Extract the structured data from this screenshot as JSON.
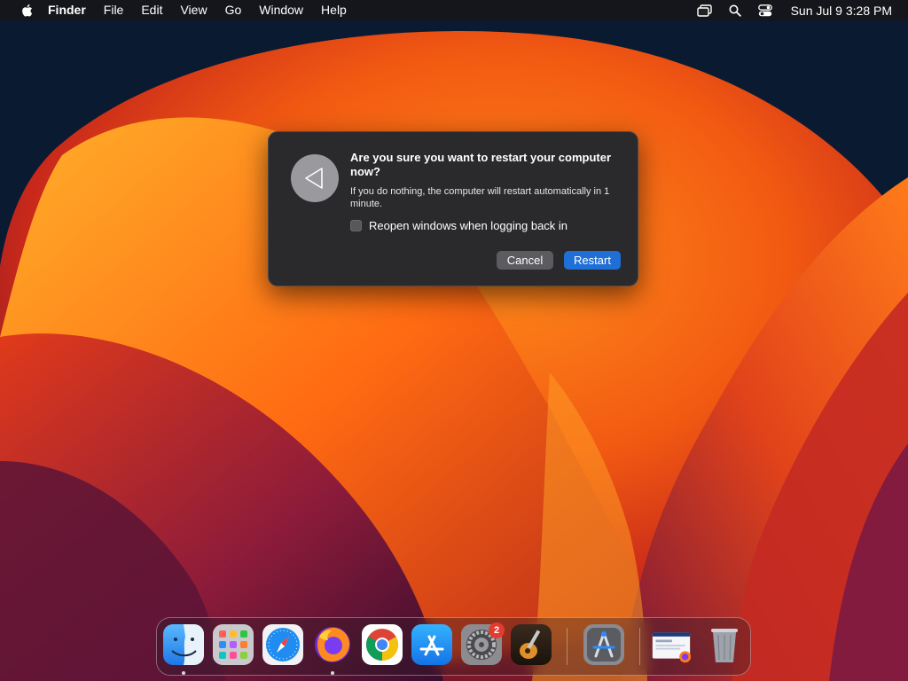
{
  "menubar": {
    "app_name": "Finder",
    "menus": [
      "File",
      "Edit",
      "View",
      "Go",
      "Window",
      "Help"
    ],
    "status_icons": [
      "screen-mirroring-icon",
      "spotlight-search-icon",
      "control-center-icon"
    ],
    "clock": "Sun Jul 9  3:28 PM"
  },
  "dialog": {
    "icon": "restart-icon",
    "title": "Are you sure you want to restart your computer now?",
    "message": "If you do nothing, the computer will restart automatically in 1 minute.",
    "checkbox_label": "Reopen windows when logging back in",
    "checkbox_checked": false,
    "cancel_label": "Cancel",
    "restart_label": "Restart",
    "accent_color": "#1f6fd6"
  },
  "dock": {
    "apps": [
      {
        "name": "Finder",
        "icon": "finder-icon",
        "running": true
      },
      {
        "name": "Launchpad",
        "icon": "launchpad-icon",
        "running": false
      },
      {
        "name": "Safari",
        "icon": "safari-icon",
        "running": false
      },
      {
        "name": "Firefox",
        "icon": "firefox-icon",
        "running": true
      },
      {
        "name": "Chrome",
        "icon": "chrome-icon",
        "running": false
      },
      {
        "name": "App Store",
        "icon": "app-store-icon",
        "running": false
      },
      {
        "name": "System Settings",
        "icon": "system-settings-icon",
        "running": false,
        "badge": "2"
      },
      {
        "name": "GarageBand",
        "icon": "garageband-icon",
        "running": false
      },
      {
        "name": "Instruments",
        "icon": "instruments-icon",
        "running": false
      },
      {
        "name": "Firefox Window",
        "icon": "firefox-window-thumbnail-icon",
        "running": false
      },
      {
        "name": "Trash",
        "icon": "trash-icon",
        "running": false
      }
    ]
  }
}
